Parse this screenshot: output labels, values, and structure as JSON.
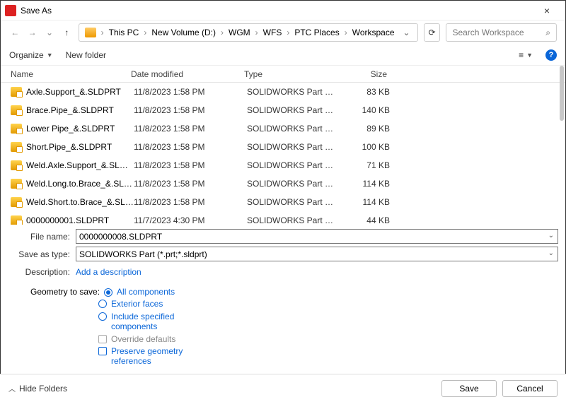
{
  "window": {
    "title": "Save As"
  },
  "breadcrumb": {
    "items": [
      "This PC",
      "New Volume (D:)",
      "WGM",
      "WFS",
      "PTC Places",
      "Workspace"
    ]
  },
  "search": {
    "placeholder": "Search Workspace"
  },
  "toolbar": {
    "organize": "Organize",
    "newfolder": "New folder"
  },
  "columns": {
    "name": "Name",
    "date": "Date modified",
    "type": "Type",
    "size": "Size"
  },
  "files": [
    {
      "name": "Axle.Support_&.SLDPRT",
      "date": "11/8/2023 1:58 PM",
      "type": "SOLIDWORKS Part Docu...",
      "size": "83 KB"
    },
    {
      "name": "Brace.Pipe_&.SLDPRT",
      "date": "11/8/2023 1:58 PM",
      "type": "SOLIDWORKS Part Docu...",
      "size": "140 KB"
    },
    {
      "name": "Lower Pipe_&.SLDPRT",
      "date": "11/8/2023 1:58 PM",
      "type": "SOLIDWORKS Part Docu...",
      "size": "89 KB"
    },
    {
      "name": "Short.Pipe_&.SLDPRT",
      "date": "11/8/2023 1:58 PM",
      "type": "SOLIDWORKS Part Docu...",
      "size": "100 KB"
    },
    {
      "name": "Weld.Axle.Support_&.SLDPRT",
      "date": "11/8/2023 1:58 PM",
      "type": "SOLIDWORKS Part Docu...",
      "size": "71 KB"
    },
    {
      "name": "Weld.Long.to.Brace_&.SLDPRT",
      "date": "11/8/2023 1:58 PM",
      "type": "SOLIDWORKS Part Docu...",
      "size": "114 KB"
    },
    {
      "name": "Weld.Short.to.Brace_&.SLDPRT",
      "date": "11/8/2023 1:58 PM",
      "type": "SOLIDWORKS Part Docu...",
      "size": "114 KB"
    },
    {
      "name": "0000000001.SLDPRT",
      "date": "11/7/2023 4:30 PM",
      "type": "SOLIDWORKS Part Docu...",
      "size": "44 KB"
    }
  ],
  "form": {
    "filename_label": "File name:",
    "filename_value": "0000000008.SLDPRT",
    "saveastype_label": "Save as type:",
    "saveastype_value": "SOLIDWORKS Part (*.prt;*.sldprt)",
    "description_label": "Description:",
    "description_value": "Add a description"
  },
  "geometry": {
    "title": "Geometry to save:",
    "all": "All components",
    "exterior": "Exterior faces",
    "include": "Include specified components",
    "override": "Override defaults",
    "preserve": "Preserve geometry references"
  },
  "footer": {
    "hide": "Hide Folders",
    "save": "Save",
    "cancel": "Cancel"
  }
}
